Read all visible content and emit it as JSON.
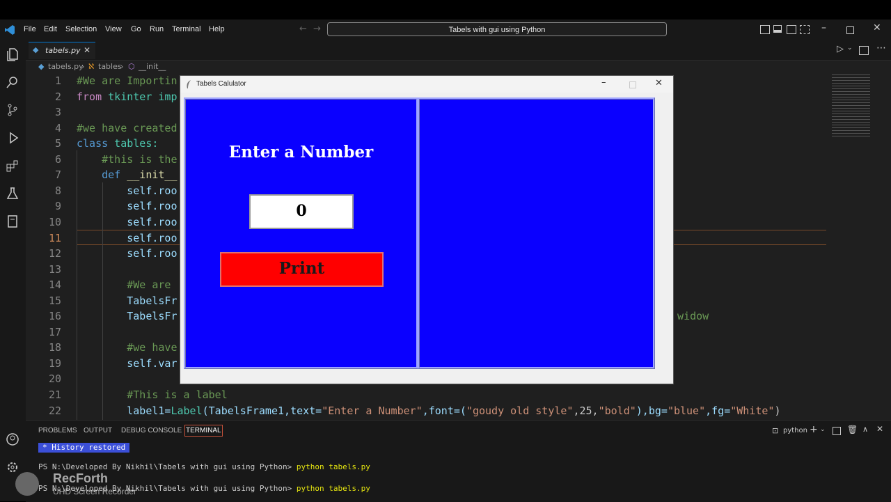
{
  "menu": [
    "File",
    "Edit",
    "Selection",
    "View",
    "Go",
    "Run",
    "Terminal",
    "Help"
  ],
  "search": {
    "text": "Tabels with gui using Python"
  },
  "tab": {
    "filename": "tabels.py"
  },
  "breadcrumbs": {
    "file": "tabels.py",
    "class": "tables",
    "method": "__init__"
  },
  "code": {
    "l1a": "#We are Importin",
    "l2a": "from",
    "l2b": " tkinter imp",
    "l4a": "#we have created",
    "l5a": "class",
    "l5b": " tables:",
    "l6a": "    #this is the",
    "l7a": "    def",
    "l7b": " __init__",
    "l8a": "        self.roo",
    "l9a": "        self.roo",
    "l10a": "        self.roo",
    "l11a": "        self.roo",
    "l12a": "        self.roo",
    "l14a": "        #We are ",
    "l15a": "        TabelsFr",
    "l16a": "        TabelsFr",
    "l16b": "n widow",
    "l18a": "        #we have",
    "l19a": "        self.var",
    "l21a": "        #This is a label",
    "l22a": "        label1=",
    "l22b": "Label",
    "l22c": "(TabelsFrame1,",
    "l22d": "text=",
    "l22e": "\"Enter a Number\"",
    "l22f": ",font=(",
    "l22g": "\"goudy old style\"",
    "l22h": ",25,",
    "l22i": "\"bold\"",
    "l22j": "),bg=",
    "l22k": "\"blue\"",
    "l22l": ",fg=",
    "l22m": "\"White\"",
    "l22n": ")"
  },
  "line_numbers": [
    "1",
    "2",
    "3",
    "4",
    "5",
    "6",
    "7",
    "8",
    "9",
    "10",
    "11",
    "12",
    "13",
    "14",
    "15",
    "16",
    "17",
    "18",
    "19",
    "20",
    "21",
    "22"
  ],
  "panel": {
    "tabs": [
      "PROBLEMS",
      "OUTPUT",
      "DEBUG CONSOLE",
      "TERMINAL"
    ],
    "active_tab": "TERMINAL",
    "shell": "python",
    "history": "History restored",
    "prompt1": "PS N:\\Developed By Nikhil\\Tabels with gui using Python> ",
    "cmd1": "python tabels.py",
    "prompt2": "PS N:\\Developed By Nikhil\\Tabels with gui using Python> ",
    "cmd2": "python tabels.py"
  },
  "tk_window": {
    "title": "Tabels Calulator",
    "label": "Enter a Number",
    "entry_value": "0",
    "button": "Print"
  },
  "watermark": {
    "brand": "RecForth",
    "sub": "UHD Screen Recorder"
  },
  "colors": {
    "frame_blue": "#0a00ff",
    "button_red": "#ff0000",
    "accent": "#0078d4"
  }
}
